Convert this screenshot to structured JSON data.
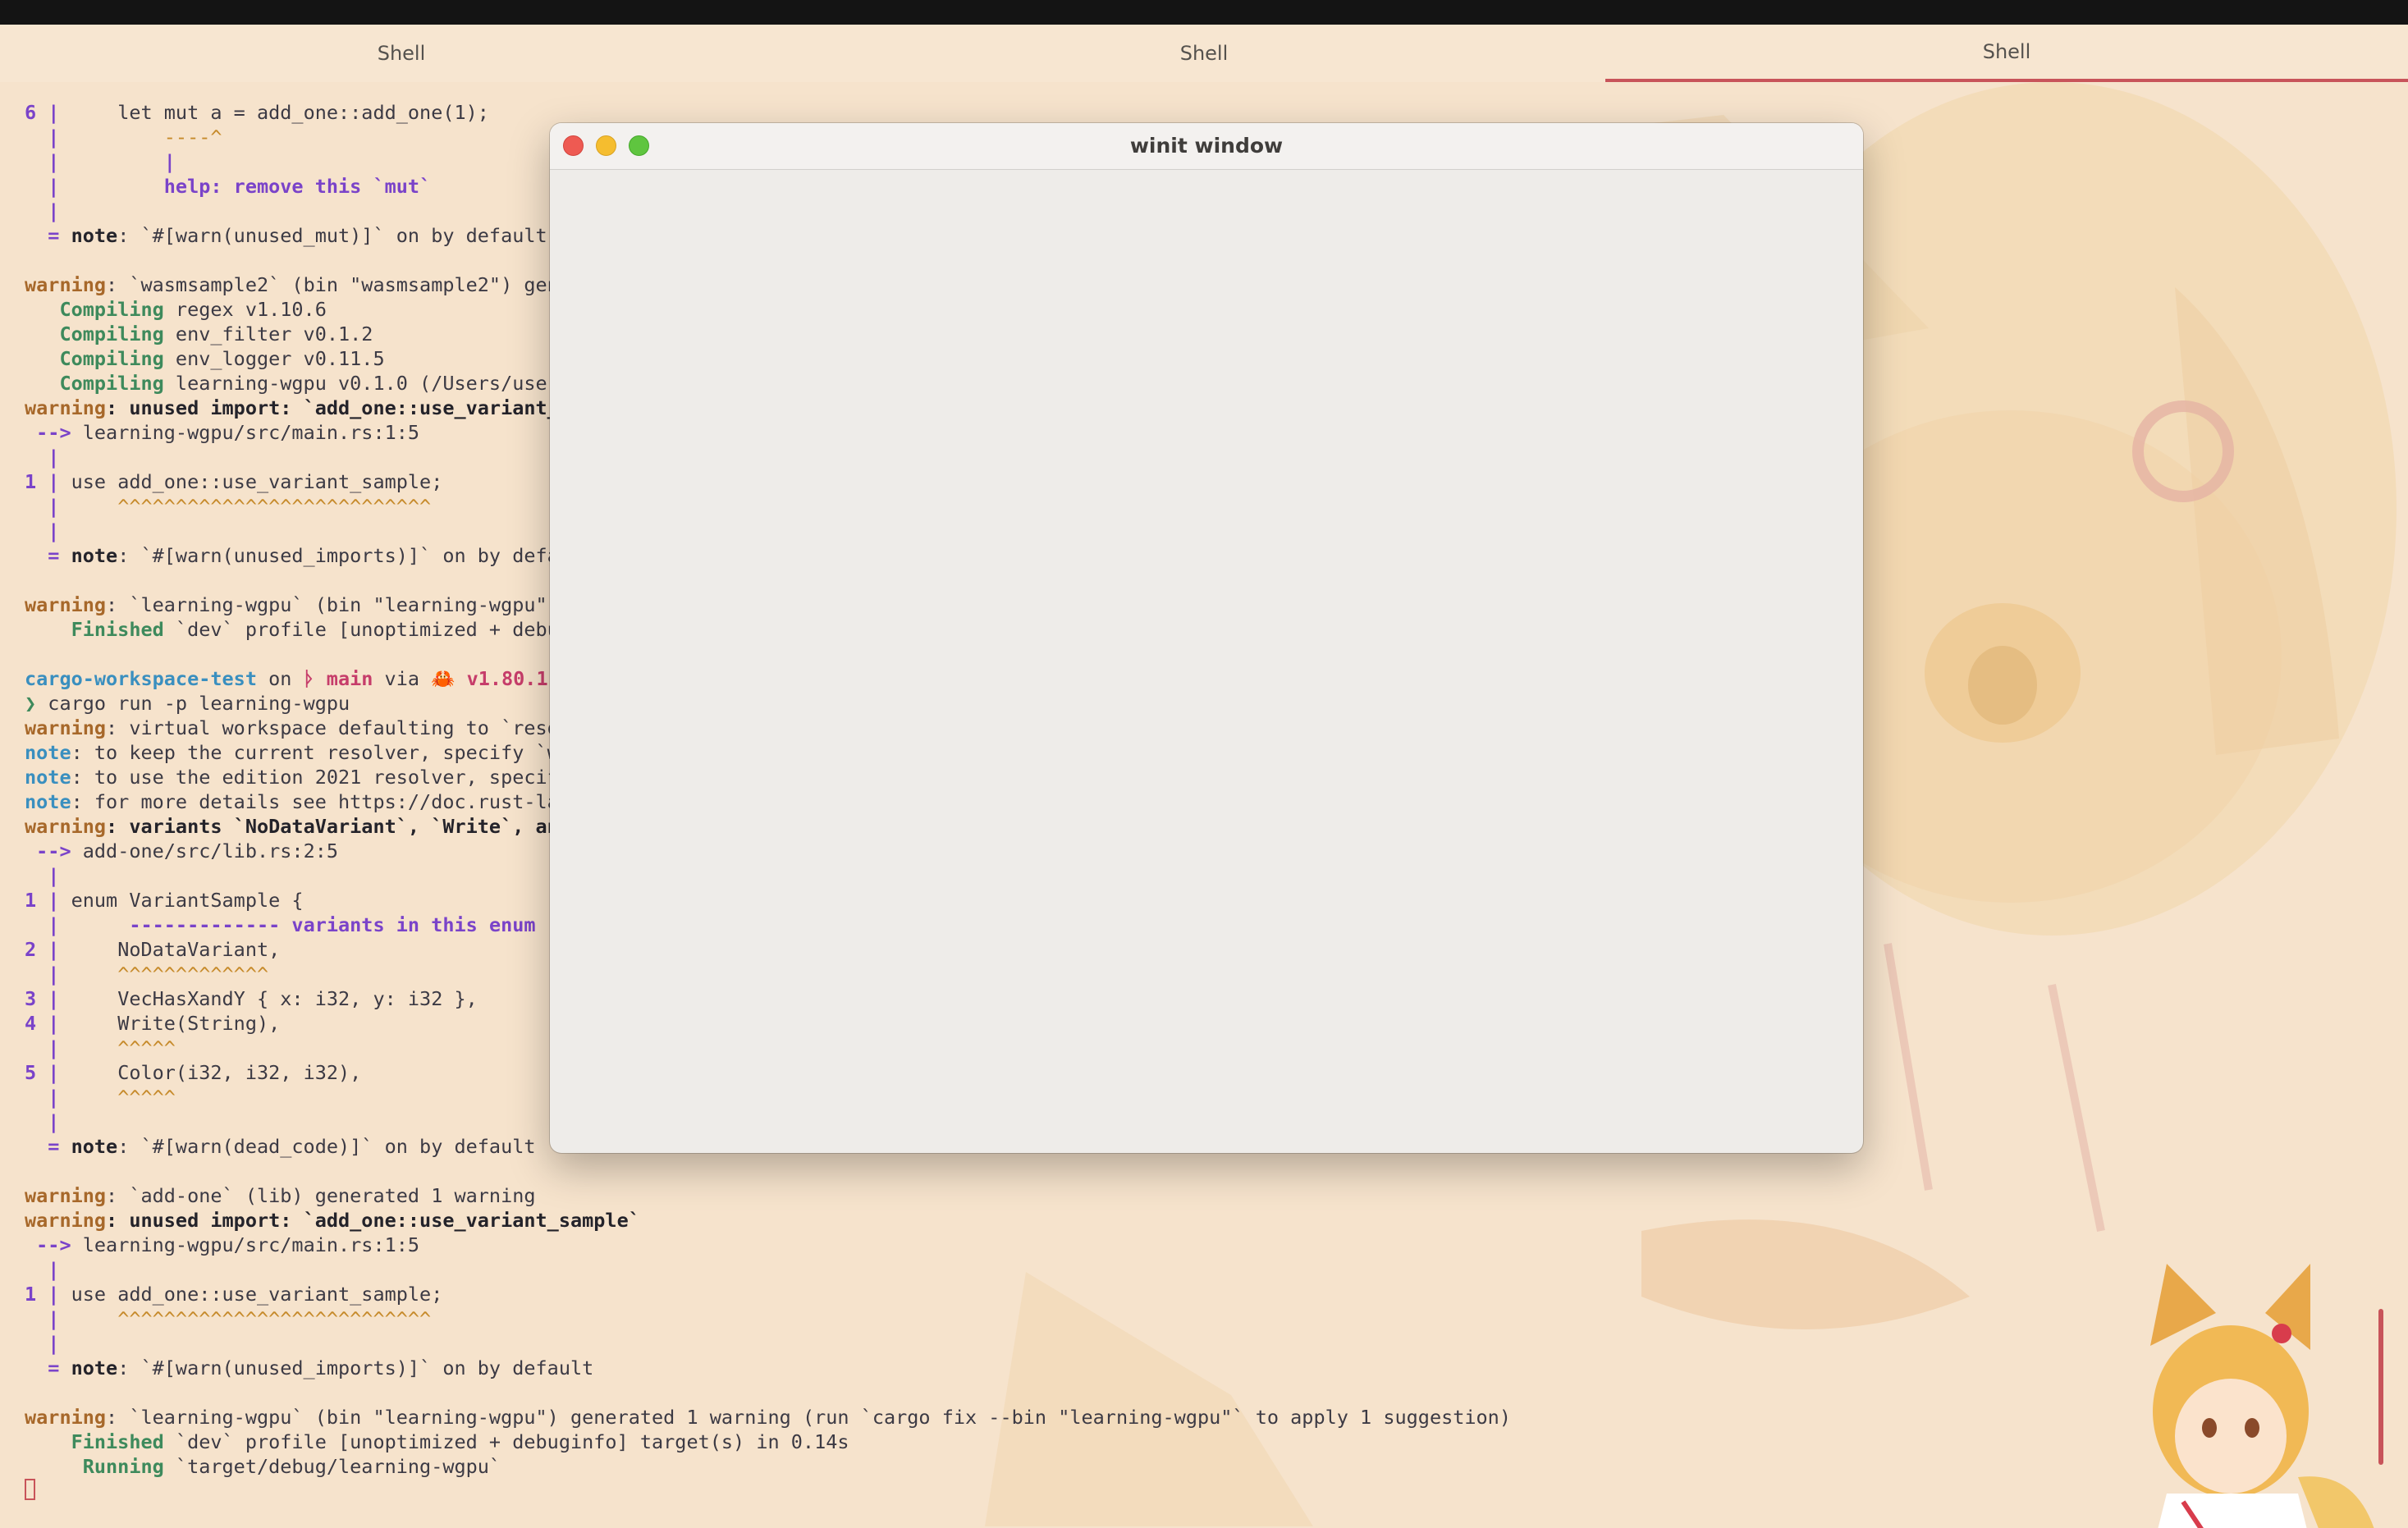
{
  "tabs": [
    {
      "label": "Shell"
    },
    {
      "label": "Shell"
    },
    {
      "label": "Shell",
      "active": true
    }
  ],
  "popup": {
    "title": "winit window"
  },
  "terminal": {
    "lines": [
      [
        {
          "t": "6 ",
          "c": "purple"
        },
        {
          "t": "|",
          "c": "purple"
        },
        {
          "t": "     let mut a = add_one::add_one(1);"
        }
      ],
      [
        {
          "t": "  |",
          "c": "purple"
        },
        {
          "t": "         ----^",
          "c": "orange"
        }
      ],
      [
        {
          "t": "  |",
          "c": "purple"
        },
        {
          "t": "         |",
          "c": "purple"
        }
      ],
      [
        {
          "t": "  |",
          "c": "purple"
        },
        {
          "t": "         help: remove this `mut`",
          "c": "purple"
        }
      ],
      [
        {
          "t": "  |",
          "c": "purple"
        }
      ],
      [
        {
          "t": "  = ",
          "c": "purple"
        },
        {
          "t": "note",
          "c": "bold"
        },
        {
          "t": ": `#[warn(unused_mut)]` on by default"
        }
      ],
      [
        {
          "t": ""
        }
      ],
      [
        {
          "t": "warning",
          "c": "warn"
        },
        {
          "t": ": `wasmsample2` (bin \"wasmsample2\") generated 1 warning"
        }
      ],
      [
        {
          "t": "   Compiling",
          "c": "green"
        },
        {
          "t": " regex v1.10.6"
        }
      ],
      [
        {
          "t": "   Compiling",
          "c": "green"
        },
        {
          "t": " env_filter v0.1.2"
        }
      ],
      [
        {
          "t": "   Compiling",
          "c": "green"
        },
        {
          "t": " env_logger v0.11.5"
        }
      ],
      [
        {
          "t": "   Compiling",
          "c": "green"
        },
        {
          "t": " learning-wgpu v0.1.0 (/Users/user"
        }
      ],
      [
        {
          "t": "warning",
          "c": "warn"
        },
        {
          "t": ": unused import: `add_one::use_variant_",
          "c": "bold"
        }
      ],
      [
        {
          "t": " --> ",
          "c": "purple"
        },
        {
          "t": "learning-wgpu/src/main.rs:1:5"
        }
      ],
      [
        {
          "t": "  |",
          "c": "purple"
        }
      ],
      [
        {
          "t": "1 ",
          "c": "purple"
        },
        {
          "t": "|",
          "c": "purple"
        },
        {
          "t": " use add_one::use_variant_sample;"
        }
      ],
      [
        {
          "t": "  |",
          "c": "purple"
        },
        {
          "t": "     ^^^^^^^^^^^^^^^^^^^^^^^^^^^",
          "c": "caret"
        }
      ],
      [
        {
          "t": "  |",
          "c": "purple"
        }
      ],
      [
        {
          "t": "  = ",
          "c": "purple"
        },
        {
          "t": "note",
          "c": "bold"
        },
        {
          "t": ": `#[warn(unused_imports)]` on by default"
        }
      ],
      [
        {
          "t": ""
        }
      ],
      [
        {
          "t": "warning",
          "c": "warn"
        },
        {
          "t": ": `learning-wgpu` (bin \"learning-wgpu\")"
        }
      ],
      [
        {
          "t": "    Finished",
          "c": "green"
        },
        {
          "t": " `dev` profile [unoptimized + debuginfo]"
        }
      ],
      [
        {
          "t": ""
        }
      ],
      [
        {
          "t": "cargo-workspace-test",
          "c": "cyan"
        },
        {
          "t": " on "
        },
        {
          "t": "ᚦ main",
          "c": "pink"
        },
        {
          "t": " via "
        },
        {
          "t": "🦀 v1.80.1",
          "c": "pink"
        }
      ],
      [
        {
          "t": "❯",
          "c": "green"
        },
        {
          "t": " cargo run -p learning-wgpu"
        }
      ],
      [
        {
          "t": "warning",
          "c": "warn"
        },
        {
          "t": ": virtual workspace defaulting to `resolver"
        }
      ],
      [
        {
          "t": "note",
          "c": "noteL"
        },
        {
          "t": ": to keep the current resolver, specify `w"
        }
      ],
      [
        {
          "t": "note",
          "c": "noteL"
        },
        {
          "t": ": to use the edition 2021 resolver, specif"
        }
      ],
      [
        {
          "t": "note",
          "c": "noteL"
        },
        {
          "t": ": for more details see https://doc.rust-la"
        }
      ],
      [
        {
          "t": "warning",
          "c": "warn"
        },
        {
          "t": ": variants `NoDataVariant`, `Write`, and",
          "c": "bold"
        }
      ],
      [
        {
          "t": " --> ",
          "c": "purple"
        },
        {
          "t": "add-one/src/lib.rs:2:5"
        }
      ],
      [
        {
          "t": "  |",
          "c": "purple"
        }
      ],
      [
        {
          "t": "1 ",
          "c": "purple"
        },
        {
          "t": "|",
          "c": "purple"
        },
        {
          "t": " enum VariantSample {"
        }
      ],
      [
        {
          "t": "  |",
          "c": "purple"
        },
        {
          "t": "      ------------- ",
          "c": "purple"
        },
        {
          "t": "variants in this enum",
          "c": "purple"
        }
      ],
      [
        {
          "t": "2 ",
          "c": "purple"
        },
        {
          "t": "|",
          "c": "purple"
        },
        {
          "t": "     NoDataVariant,"
        }
      ],
      [
        {
          "t": "  |",
          "c": "purple"
        },
        {
          "t": "     ^^^^^^^^^^^^^",
          "c": "caret"
        }
      ],
      [
        {
          "t": "3 ",
          "c": "purple"
        },
        {
          "t": "|",
          "c": "purple"
        },
        {
          "t": "     VecHasXandY { x: i32, y: i32 },"
        }
      ],
      [
        {
          "t": "4 ",
          "c": "purple"
        },
        {
          "t": "|",
          "c": "purple"
        },
        {
          "t": "     Write(String),"
        }
      ],
      [
        {
          "t": "  |",
          "c": "purple"
        },
        {
          "t": "     ^^^^^",
          "c": "caret"
        }
      ],
      [
        {
          "t": "5 ",
          "c": "purple"
        },
        {
          "t": "|",
          "c": "purple"
        },
        {
          "t": "     Color(i32, i32, i32),"
        }
      ],
      [
        {
          "t": "  |",
          "c": "purple"
        },
        {
          "t": "     ^^^^^",
          "c": "caret"
        }
      ],
      [
        {
          "t": "  |",
          "c": "purple"
        }
      ],
      [
        {
          "t": "  = ",
          "c": "purple"
        },
        {
          "t": "note",
          "c": "bold"
        },
        {
          "t": ": `#[warn(dead_code)]` on by default"
        }
      ],
      [
        {
          "t": ""
        }
      ],
      [
        {
          "t": "warning",
          "c": "warn"
        },
        {
          "t": ": `add-one` (lib) generated 1 warning"
        }
      ],
      [
        {
          "t": "warning",
          "c": "warn"
        },
        {
          "t": ": unused import: `add_one::use_variant_sample`",
          "c": "bold"
        }
      ],
      [
        {
          "t": " --> ",
          "c": "purple"
        },
        {
          "t": "learning-wgpu/src/main.rs:1:5"
        }
      ],
      [
        {
          "t": "  |",
          "c": "purple"
        }
      ],
      [
        {
          "t": "1 ",
          "c": "purple"
        },
        {
          "t": "|",
          "c": "purple"
        },
        {
          "t": " use add_one::use_variant_sample;"
        }
      ],
      [
        {
          "t": "  |",
          "c": "purple"
        },
        {
          "t": "     ^^^^^^^^^^^^^^^^^^^^^^^^^^^",
          "c": "caret"
        }
      ],
      [
        {
          "t": "  |",
          "c": "purple"
        }
      ],
      [
        {
          "t": "  = ",
          "c": "purple"
        },
        {
          "t": "note",
          "c": "bold"
        },
        {
          "t": ": `#[warn(unused_imports)]` on by default"
        }
      ],
      [
        {
          "t": ""
        }
      ],
      [
        {
          "t": "warning",
          "c": "warn"
        },
        {
          "t": ": `learning-wgpu` (bin \"learning-wgpu\") generated 1 warning (run `cargo fix --bin \"learning-wgpu\"` to apply 1 suggestion)"
        }
      ],
      [
        {
          "t": "    Finished",
          "c": "green"
        },
        {
          "t": " `dev` profile [unoptimized + debuginfo] target(s) in 0.14s"
        }
      ],
      [
        {
          "t": "     Running",
          "c": "green"
        },
        {
          "t": " `target/debug/learning-wgpu`"
        }
      ]
    ]
  },
  "colors": {
    "background": "#f6e3cc",
    "accent": "#c8545a",
    "warning": "#a7682a",
    "note": "#3a8fbf",
    "gutter": "#7a43c9",
    "compiling": "#3e8a5c"
  },
  "icons": {
    "close": "close-icon",
    "minimize": "minimize-icon",
    "maximize": "maximize-icon"
  }
}
